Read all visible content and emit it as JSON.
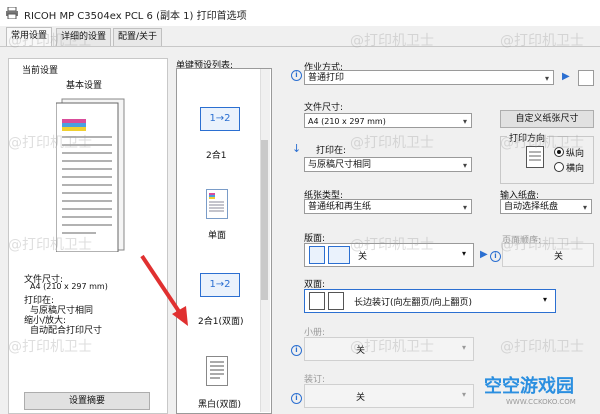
{
  "window": {
    "title": "RICOH MP C3504ex PCL 6 (副本 1) 打印首选项"
  },
  "tabs": [
    {
      "label": "常用设置"
    },
    {
      "label": "详细的设置"
    },
    {
      "label": "配置/关于"
    }
  ],
  "left": {
    "current_settings_label": "当前设置",
    "basic_settings_label": "基本设置",
    "info_lines": [
      "文件尺寸:",
      "A4 (210 x 297 mm)",
      "打印在:",
      "与原稿尺寸相同",
      "缩小/放大:",
      "自动配合打印尺寸"
    ],
    "summary_button": "设置摘要"
  },
  "presets": {
    "title": "单键预设列表:",
    "items": [
      {
        "label": "2合1",
        "icon": "1→2"
      },
      {
        "label": "单面",
        "icon": ""
      },
      {
        "label": "2合1(双面)",
        "icon": "1→2"
      },
      {
        "label": "黑白(双面)",
        "icon": ""
      }
    ]
  },
  "job": {
    "label": "作业方式:",
    "value": "普通打印"
  },
  "paper_size": {
    "label": "文件尺寸:",
    "value": "A4 (210 x 297 mm)",
    "custom_button": "自定义纸张尺寸"
  },
  "print_on": {
    "label": "打印在:",
    "value": "与原稿尺寸相同"
  },
  "orientation": {
    "label": "打印方向",
    "options": [
      "纵向",
      "横向"
    ]
  },
  "paper_type": {
    "label": "纸张类型:",
    "value": "普通纸和再生纸"
  },
  "input_tray": {
    "label": "输入纸盘:",
    "value": "自动选择纸盘"
  },
  "layout": {
    "label": "版面:",
    "value": "关"
  },
  "pages_per_sheet": {
    "label": "页面顺序:",
    "value": "关"
  },
  "duplex": {
    "label": "双面:",
    "value": "长边装订(向左翻页/向上翻页)"
  },
  "booklet": {
    "label": "小册:",
    "value": "关"
  },
  "staple": {
    "label": "装订:",
    "value": "关"
  },
  "watermark_text": "@打印机卫士",
  "brand": {
    "name": "空空游戏园",
    "url": "WWW.CCKOKO.COM"
  }
}
